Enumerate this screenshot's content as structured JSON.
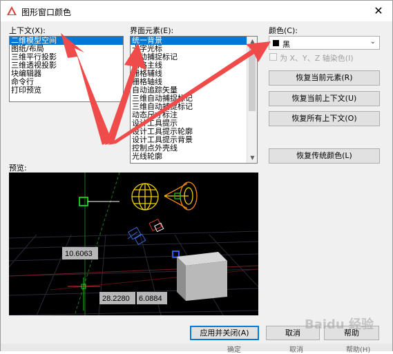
{
  "window": {
    "title": "图形窗口颜色",
    "close_glyph": "✕"
  },
  "context": {
    "label": "上下文(X):",
    "items": [
      "二维模型空间",
      "图纸/布局",
      "三维平行投影",
      "三维透视投影",
      "块编辑器",
      "命令行",
      "打印预览"
    ],
    "selected_index": 0
  },
  "interface": {
    "label": "界面元素(E):",
    "items": [
      "统一背景",
      "十字光标",
      "自动捕捉标记",
      "栅格主线",
      "栅格辅线",
      "栅格轴线",
      "自动追踪矢量",
      "三维自动捕捉标记",
      "三维自动捕捉标记",
      "动态尺寸标注",
      "设计工具提示",
      "设计工具提示轮廓",
      "设计工具提示背景",
      "控制点外壳线",
      "光线轮廓"
    ],
    "selected_index": 0
  },
  "color": {
    "label": "颜色(C):",
    "value": "黑",
    "swatch": "#000000",
    "tint_checkbox_label": "为 X、Y、Z 轴染色(I)",
    "tint_checked": false
  },
  "buttons": {
    "restore_element": "恢复当前元素(R)",
    "restore_context": "恢复当前上下文(U)",
    "restore_all": "恢复所有上下文(O)",
    "restore_classic": "恢复传统颜色(L)",
    "apply_close": "应用并关闭(A)",
    "cancel": "取消",
    "help": "帮助"
  },
  "preview": {
    "label": "预览:",
    "dim_1": "10.6063",
    "dim_2": "28.2280",
    "dim_3": "6.0884"
  },
  "footer_ghost": {
    "ok": "确定",
    "cancel": "取消",
    "help": "帮助(H)"
  },
  "watermark": "Baidu 经验",
  "colors": {
    "selection": "#0078d7",
    "annotation_arrow": "#ef4b4b",
    "preview_bg": "#000000"
  }
}
